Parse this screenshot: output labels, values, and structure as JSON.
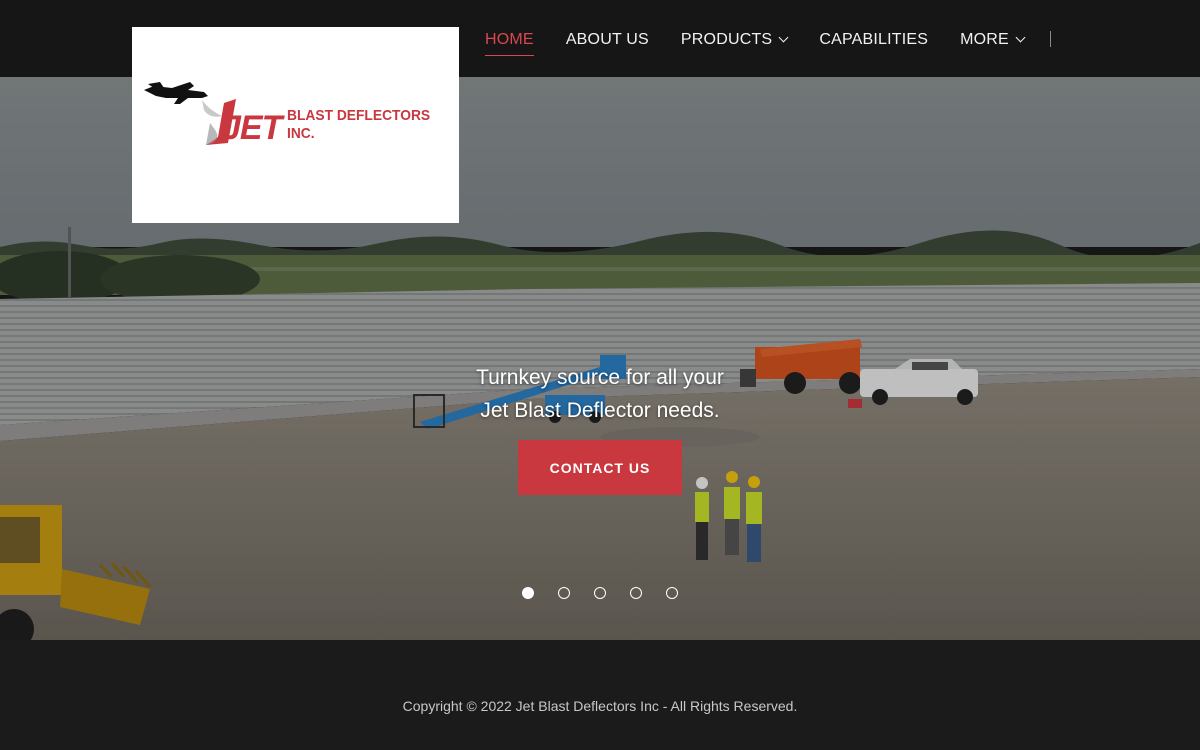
{
  "header": {
    "nav": [
      {
        "label": "HOME",
        "active": true,
        "has_dropdown": false
      },
      {
        "label": "ABOUT US",
        "active": false,
        "has_dropdown": false
      },
      {
        "label": "PRODUCTS",
        "active": false,
        "has_dropdown": true
      },
      {
        "label": "CAPABILITIES",
        "active": false,
        "has_dropdown": false
      },
      {
        "label": "MORE",
        "active": false,
        "has_dropdown": true
      }
    ]
  },
  "logo": {
    "brand_word": "JET",
    "brand_rest": "BLAST DEFLECTORS INC.",
    "icon": "jet-plane-icon"
  },
  "hero": {
    "tagline_line1": "Turnkey source for all your",
    "tagline_line2": "Jet Blast Deflector needs.",
    "cta_label": "CONTACT US",
    "slides_total": 5,
    "active_slide": 1
  },
  "footer": {
    "copyright": "Copyright © 2022 Jet Blast Deflectors Inc - All Rights Reserved."
  },
  "colors": {
    "accent": "#c9373f",
    "active_nav": "#d9474f",
    "header_bg": "#161616",
    "footer_bg": "#1b1b1b"
  }
}
